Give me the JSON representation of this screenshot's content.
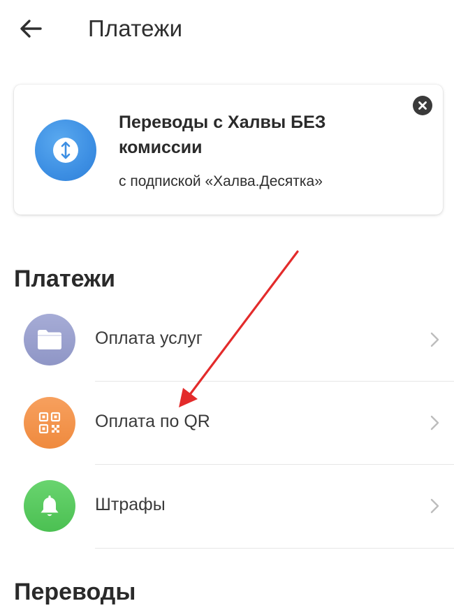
{
  "header": {
    "title": "Платежи",
    "back_icon": "arrow-left-icon"
  },
  "promo": {
    "title": "Переводы с Халвы БЕЗ комиссии",
    "subtitle": "с подпиской «Халва.Десятка»",
    "icon": "transfer-arrows-icon",
    "close_icon": "close-icon",
    "accent": "#3d8fe3"
  },
  "payments_section": {
    "title": "Платежи",
    "items": [
      {
        "label": "Оплата услуг",
        "icon": "folder-icon",
        "color": "#9aa0cf"
      },
      {
        "label": "Оплата по QR",
        "icon": "qr-code-icon",
        "color": "#f4974f"
      },
      {
        "label": "Штрафы",
        "icon": "bell-icon",
        "color": "#59ca5f"
      }
    ]
  },
  "transfers_section": {
    "title": "Переводы"
  },
  "annotation": {
    "color": "#e32b2b"
  }
}
